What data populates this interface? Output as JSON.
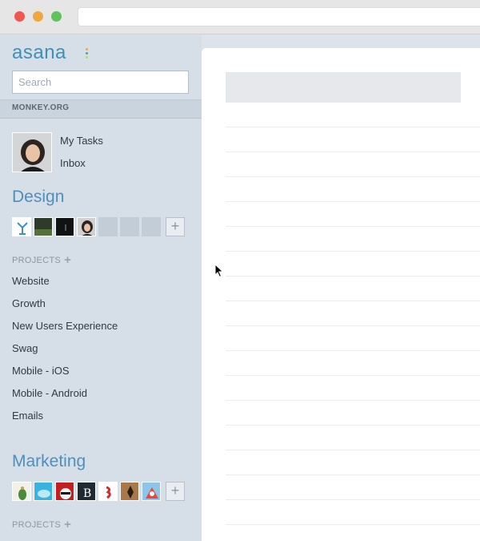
{
  "app": {
    "logo_text": "asana",
    "logo_dot_colors": [
      "#f7a33b",
      "#3bb08f",
      "#b6dd58"
    ]
  },
  "search": {
    "placeholder": "Search"
  },
  "workspace": {
    "name": "MONKEY.ORG"
  },
  "my_links": [
    {
      "label": "My Tasks"
    },
    {
      "label": "Inbox"
    }
  ],
  "teams": [
    {
      "name": "Design",
      "projects_label": "PROJECTS",
      "projects": [
        {
          "label": "Website"
        },
        {
          "label": "Growth"
        },
        {
          "label": "New Users Experience"
        },
        {
          "label": "Swag"
        },
        {
          "label": "Mobile - iOS"
        },
        {
          "label": "Mobile - Android"
        },
        {
          "label": "Emails"
        }
      ]
    },
    {
      "name": "Marketing",
      "projects_label": "PROJECTS",
      "projects": []
    }
  ],
  "colors": {
    "accent": "#4c90c0",
    "sidebar_bg": "#d6dfe8"
  }
}
